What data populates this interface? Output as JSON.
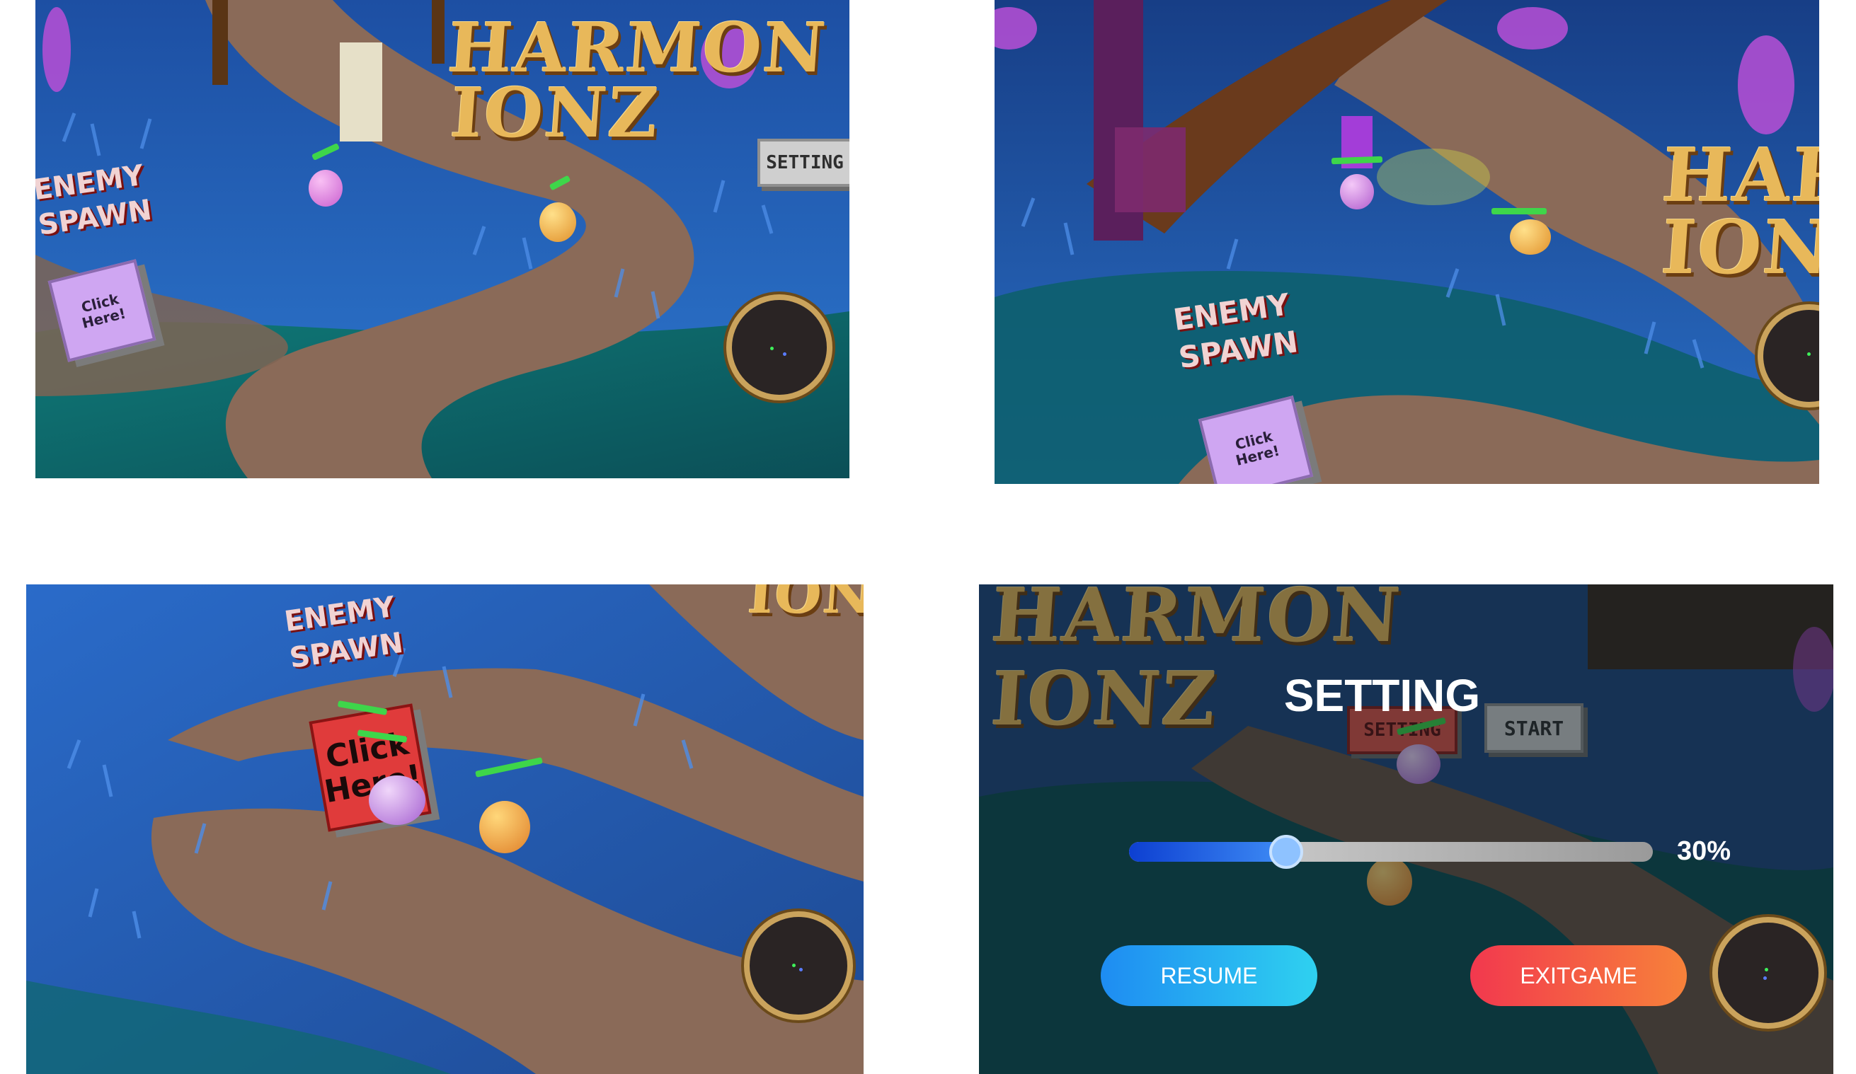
{
  "colors": {
    "title_gold": "#e8b85a",
    "grass_blue": "#2f6fd0",
    "path_brown": "#8a6a58",
    "hp_green": "#3ed64a",
    "resume_gradient": [
      "#1e8cf2",
      "#2fd1f0"
    ],
    "exitgame_gradient": [
      "#f2384e",
      "#f7823a"
    ],
    "joystick_ring": "#caa35c"
  },
  "panels": [
    {
      "title_line1": "HARMON",
      "title_line2": "IONZ",
      "enemy_spawn_line1": "ENEMY",
      "enemy_spawn_line2": "SPAWN",
      "setting_sign": "SETTING",
      "click_box": "Click\nHere!",
      "joystick_icon": "joystick-icon"
    },
    {
      "title_line1": "HAR",
      "title_line2": "IONZ",
      "enemy_spawn_line1": "ENEMY",
      "enemy_spawn_line2": "SPAWN",
      "click_box": "Click\nHere!",
      "joystick_icon": "joystick-icon"
    },
    {
      "title_line1": "IONZ",
      "enemy_spawn_line1": "ENEMY",
      "enemy_spawn_line2": "SPAWN",
      "click_box": "Click\nHere!",
      "joystick_icon": "joystick-icon"
    },
    {
      "title_line1": "HARMON",
      "title_line2": "IONZ",
      "setting_sign": "SETTING",
      "start_sign": "START",
      "settings_menu": {
        "heading": "SETTING",
        "volume_percent": 30,
        "volume_label": "30%",
        "resume_label": "RESUME",
        "exit_label": "EXITGAME"
      },
      "joystick_icon": "joystick-icon"
    }
  ]
}
